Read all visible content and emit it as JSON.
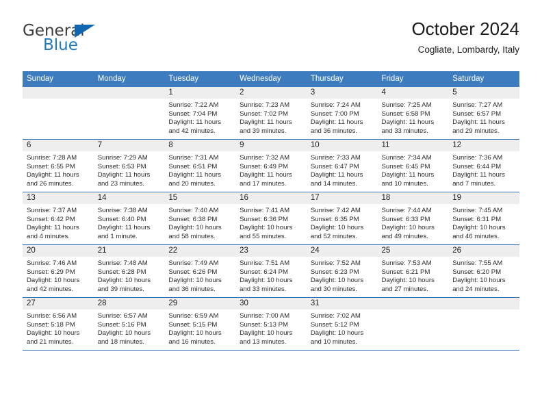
{
  "brand": {
    "name_part1": "General",
    "name_part2": "Blue",
    "triangle_icon": "triangle-icon",
    "color_dark": "#3c3c3c",
    "color_blue": "#1f7ac4"
  },
  "header": {
    "title": "October 2024",
    "subtitle": "Cogliate, Lombardy, Italy"
  },
  "theme": {
    "header_bar": "#3d7cbe",
    "row_rule": "#2f6fb0",
    "daynum_band": "#eeeeee",
    "text": "#2a2a2a"
  },
  "weekdays": [
    "Sunday",
    "Monday",
    "Tuesday",
    "Wednesday",
    "Thursday",
    "Friday",
    "Saturday"
  ],
  "labels": {
    "sunrise": "Sunrise:",
    "sunset": "Sunset:",
    "daylight": "Daylight:"
  },
  "weeks": [
    [
      {
        "day": "",
        "sunrise": "",
        "sunset": "",
        "daylight_a": "",
        "daylight_b": ""
      },
      {
        "day": "",
        "sunrise": "",
        "sunset": "",
        "daylight_a": "",
        "daylight_b": ""
      },
      {
        "day": "1",
        "sunrise": "Sunrise: 7:22 AM",
        "sunset": "Sunset: 7:04 PM",
        "daylight_a": "Daylight: 11 hours",
        "daylight_b": "and 42 minutes."
      },
      {
        "day": "2",
        "sunrise": "Sunrise: 7:23 AM",
        "sunset": "Sunset: 7:02 PM",
        "daylight_a": "Daylight: 11 hours",
        "daylight_b": "and 39 minutes."
      },
      {
        "day": "3",
        "sunrise": "Sunrise: 7:24 AM",
        "sunset": "Sunset: 7:00 PM",
        "daylight_a": "Daylight: 11 hours",
        "daylight_b": "and 36 minutes."
      },
      {
        "day": "4",
        "sunrise": "Sunrise: 7:25 AM",
        "sunset": "Sunset: 6:58 PM",
        "daylight_a": "Daylight: 11 hours",
        "daylight_b": "and 33 minutes."
      },
      {
        "day": "5",
        "sunrise": "Sunrise: 7:27 AM",
        "sunset": "Sunset: 6:57 PM",
        "daylight_a": "Daylight: 11 hours",
        "daylight_b": "and 29 minutes."
      }
    ],
    [
      {
        "day": "6",
        "sunrise": "Sunrise: 7:28 AM",
        "sunset": "Sunset: 6:55 PM",
        "daylight_a": "Daylight: 11 hours",
        "daylight_b": "and 26 minutes."
      },
      {
        "day": "7",
        "sunrise": "Sunrise: 7:29 AM",
        "sunset": "Sunset: 6:53 PM",
        "daylight_a": "Daylight: 11 hours",
        "daylight_b": "and 23 minutes."
      },
      {
        "day": "8",
        "sunrise": "Sunrise: 7:31 AM",
        "sunset": "Sunset: 6:51 PM",
        "daylight_a": "Daylight: 11 hours",
        "daylight_b": "and 20 minutes."
      },
      {
        "day": "9",
        "sunrise": "Sunrise: 7:32 AM",
        "sunset": "Sunset: 6:49 PM",
        "daylight_a": "Daylight: 11 hours",
        "daylight_b": "and 17 minutes."
      },
      {
        "day": "10",
        "sunrise": "Sunrise: 7:33 AM",
        "sunset": "Sunset: 6:47 PM",
        "daylight_a": "Daylight: 11 hours",
        "daylight_b": "and 14 minutes."
      },
      {
        "day": "11",
        "sunrise": "Sunrise: 7:34 AM",
        "sunset": "Sunset: 6:45 PM",
        "daylight_a": "Daylight: 11 hours",
        "daylight_b": "and 10 minutes."
      },
      {
        "day": "12",
        "sunrise": "Sunrise: 7:36 AM",
        "sunset": "Sunset: 6:44 PM",
        "daylight_a": "Daylight: 11 hours",
        "daylight_b": "and 7 minutes."
      }
    ],
    [
      {
        "day": "13",
        "sunrise": "Sunrise: 7:37 AM",
        "sunset": "Sunset: 6:42 PM",
        "daylight_a": "Daylight: 11 hours",
        "daylight_b": "and 4 minutes."
      },
      {
        "day": "14",
        "sunrise": "Sunrise: 7:38 AM",
        "sunset": "Sunset: 6:40 PM",
        "daylight_a": "Daylight: 11 hours",
        "daylight_b": "and 1 minute."
      },
      {
        "day": "15",
        "sunrise": "Sunrise: 7:40 AM",
        "sunset": "Sunset: 6:38 PM",
        "daylight_a": "Daylight: 10 hours",
        "daylight_b": "and 58 minutes."
      },
      {
        "day": "16",
        "sunrise": "Sunrise: 7:41 AM",
        "sunset": "Sunset: 6:36 PM",
        "daylight_a": "Daylight: 10 hours",
        "daylight_b": "and 55 minutes."
      },
      {
        "day": "17",
        "sunrise": "Sunrise: 7:42 AM",
        "sunset": "Sunset: 6:35 PM",
        "daylight_a": "Daylight: 10 hours",
        "daylight_b": "and 52 minutes."
      },
      {
        "day": "18",
        "sunrise": "Sunrise: 7:44 AM",
        "sunset": "Sunset: 6:33 PM",
        "daylight_a": "Daylight: 10 hours",
        "daylight_b": "and 49 minutes."
      },
      {
        "day": "19",
        "sunrise": "Sunrise: 7:45 AM",
        "sunset": "Sunset: 6:31 PM",
        "daylight_a": "Daylight: 10 hours",
        "daylight_b": "and 46 minutes."
      }
    ],
    [
      {
        "day": "20",
        "sunrise": "Sunrise: 7:46 AM",
        "sunset": "Sunset: 6:29 PM",
        "daylight_a": "Daylight: 10 hours",
        "daylight_b": "and 42 minutes."
      },
      {
        "day": "21",
        "sunrise": "Sunrise: 7:48 AM",
        "sunset": "Sunset: 6:28 PM",
        "daylight_a": "Daylight: 10 hours",
        "daylight_b": "and 39 minutes."
      },
      {
        "day": "22",
        "sunrise": "Sunrise: 7:49 AM",
        "sunset": "Sunset: 6:26 PM",
        "daylight_a": "Daylight: 10 hours",
        "daylight_b": "and 36 minutes."
      },
      {
        "day": "23",
        "sunrise": "Sunrise: 7:51 AM",
        "sunset": "Sunset: 6:24 PM",
        "daylight_a": "Daylight: 10 hours",
        "daylight_b": "and 33 minutes."
      },
      {
        "day": "24",
        "sunrise": "Sunrise: 7:52 AM",
        "sunset": "Sunset: 6:23 PM",
        "daylight_a": "Daylight: 10 hours",
        "daylight_b": "and 30 minutes."
      },
      {
        "day": "25",
        "sunrise": "Sunrise: 7:53 AM",
        "sunset": "Sunset: 6:21 PM",
        "daylight_a": "Daylight: 10 hours",
        "daylight_b": "and 27 minutes."
      },
      {
        "day": "26",
        "sunrise": "Sunrise: 7:55 AM",
        "sunset": "Sunset: 6:20 PM",
        "daylight_a": "Daylight: 10 hours",
        "daylight_b": "and 24 minutes."
      }
    ],
    [
      {
        "day": "27",
        "sunrise": "Sunrise: 6:56 AM",
        "sunset": "Sunset: 5:18 PM",
        "daylight_a": "Daylight: 10 hours",
        "daylight_b": "and 21 minutes."
      },
      {
        "day": "28",
        "sunrise": "Sunrise: 6:57 AM",
        "sunset": "Sunset: 5:16 PM",
        "daylight_a": "Daylight: 10 hours",
        "daylight_b": "and 18 minutes."
      },
      {
        "day": "29",
        "sunrise": "Sunrise: 6:59 AM",
        "sunset": "Sunset: 5:15 PM",
        "daylight_a": "Daylight: 10 hours",
        "daylight_b": "and 16 minutes."
      },
      {
        "day": "30",
        "sunrise": "Sunrise: 7:00 AM",
        "sunset": "Sunset: 5:13 PM",
        "daylight_a": "Daylight: 10 hours",
        "daylight_b": "and 13 minutes."
      },
      {
        "day": "31",
        "sunrise": "Sunrise: 7:02 AM",
        "sunset": "Sunset: 5:12 PM",
        "daylight_a": "Daylight: 10 hours",
        "daylight_b": "and 10 minutes."
      },
      {
        "day": "",
        "sunrise": "",
        "sunset": "",
        "daylight_a": "",
        "daylight_b": ""
      },
      {
        "day": "",
        "sunrise": "",
        "sunset": "",
        "daylight_a": "",
        "daylight_b": ""
      }
    ]
  ]
}
